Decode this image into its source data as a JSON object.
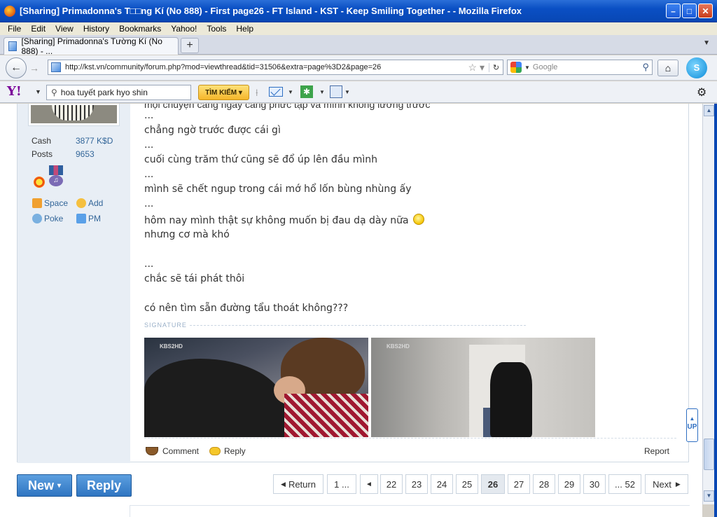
{
  "window": {
    "title": "[Sharing] Primadonna's T□□ng Kí (No 888) - First page26 - FT Island - KST - Keep Smiling Together - - Mozilla Firefox",
    "minimize": "–",
    "maximize": "□",
    "close": "✕"
  },
  "menu": [
    "File",
    "Edit",
    "View",
    "History",
    "Bookmarks",
    "Yahoo!",
    "Tools",
    "Help"
  ],
  "tab": {
    "label": "[Sharing] Primadonna's Tường Kí (No 888) - ...",
    "new_tab": "+"
  },
  "nav": {
    "back": "←",
    "forward": "→",
    "url": "http://kst.vn/community/forum.php?mod=viewthread&tid=31506&extra=page%3D2&page=26",
    "search_placeholder": "Google"
  },
  "yahoo_toolbar": {
    "logo": "Y!",
    "search_value": "hoa tuyết park hyo shin",
    "search_button": "TÌM KIẾM"
  },
  "user_panel": {
    "stats": [
      {
        "label": "Cash",
        "value": "3877 K$D"
      },
      {
        "label": "Posts",
        "value": "9653"
      }
    ],
    "links": [
      "Space",
      "Add",
      "Poke",
      "PM"
    ]
  },
  "post": {
    "cut_line": "mọi chuyện càng ngày càng phức tạp và mình không lường trước",
    "lines": [
      "...",
      "chẳng ngờ trước được cái gì",
      "...",
      "cuối cùng trăm thứ cũng sẽ đổ úp lên đầu mình",
      "...",
      "mình sẽ chết ngup trong cái mớ hổ lốn bùng nhùng ấy",
      "...",
      "hôm nay mình thật sự không muốn bị đau dạ dày nữa",
      "nhưng cơ mà khó",
      "...",
      "chắc sẽ tái phát thôi",
      "có nên tìm sẵn đường tẩu thoát không???"
    ],
    "signature_label": "SIGNATURE",
    "image_watermark": "KBS2HD",
    "footer": {
      "comment": "Comment",
      "reply": "Reply",
      "report": "Report"
    }
  },
  "actions": {
    "new": "New",
    "reply": "Reply"
  },
  "pagination": [
    "Return",
    "1 ...",
    "◄",
    "22",
    "23",
    "24",
    "25",
    "26",
    "27",
    "28",
    "29",
    "30",
    "... 52",
    "Next"
  ],
  "pagination_current": "26",
  "scroll_top_label": "UP",
  "colors": {
    "accent": "#2f75c2",
    "link": "#336699",
    "titlebar": "#0a4fc4"
  }
}
